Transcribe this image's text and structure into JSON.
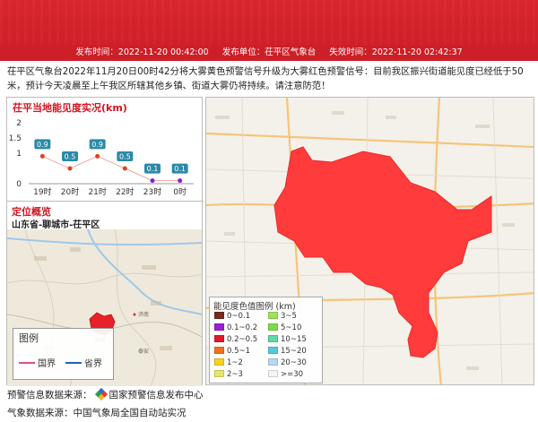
{
  "header": {
    "publish_time": "发布时间：2022-11-20 00:42:00",
    "publisher": "发布单位：茌平区气象台",
    "expire_time": "失效时间：2022-11-20 02:42:37"
  },
  "description": "茌平区气象台2022年11月20日00时42分将大雾黄色预警信号升级为大雾红色预警信号：目前我区振兴街道能见度已经低于50米，预计今天凌晨至上午我区所辖其他乡镇、街道大雾仍将持续。请注意防范！",
  "visibility": {
    "title": "茌平当地能见度实况(km)"
  },
  "chart_data": {
    "type": "line",
    "title": "茌平当地能见度实况(km)",
    "categories": [
      "19时",
      "20时",
      "21时",
      "22时",
      "23时",
      "0时"
    ],
    "values": [
      0.9,
      0.5,
      0.9,
      0.5,
      0.1,
      0.1
    ],
    "data_labels": [
      "0.9",
      "0.5",
      "0.9",
      "0.5",
      "0.1",
      "0.1"
    ],
    "yticks": [
      "0",
      "1",
      "1.5",
      "2"
    ],
    "ylim": [
      0,
      2
    ],
    "point_colors": [
      "#e0421f",
      "#e0421f",
      "#e0421f",
      "#e0421f",
      "#8a1fd6",
      "#8a1fd6"
    ],
    "label_bg": "#2a8aa8",
    "line_color": "#f0a8a0"
  },
  "location": {
    "title": "定位概览",
    "path": "山东省-聊城市-茌平区",
    "legend_title": "图例",
    "national_border": "国界",
    "provincial_border": "省界",
    "city_labels": [
      "聊城",
      "济南",
      "泰安"
    ]
  },
  "map_legend": {
    "title": "能见度色值图例 (km)",
    "items": [
      {
        "label": "0~0.1",
        "color": "#7a2b1b"
      },
      {
        "label": "3~5",
        "color": "#9ee35a"
      },
      {
        "label": "0.1~0.2",
        "color": "#9b1fd8"
      },
      {
        "label": "5~10",
        "color": "#7edb48"
      },
      {
        "label": "0.2~0.5",
        "color": "#e8162c"
      },
      {
        "label": "10~15",
        "color": "#5fd9a6"
      },
      {
        "label": "0.5~1",
        "color": "#f0721e"
      },
      {
        "label": "15~20",
        "color": "#54c9e0"
      },
      {
        "label": "1~2",
        "color": "#f4d21f"
      },
      {
        "label": "20~30",
        "color": "#b9d9ec"
      },
      {
        "label": "2~3",
        "color": "#e8e56a"
      },
      {
        "label": ">=30",
        "color": "#f4f4f4"
      }
    ]
  },
  "warning_area_color": "#ff3b3b",
  "footer": {
    "source_prefix": "预警信息数据来源：",
    "source_name": "国家预警信息发布中心",
    "weather_source": "气象数据来源：中国气象局全国自动站实况"
  }
}
